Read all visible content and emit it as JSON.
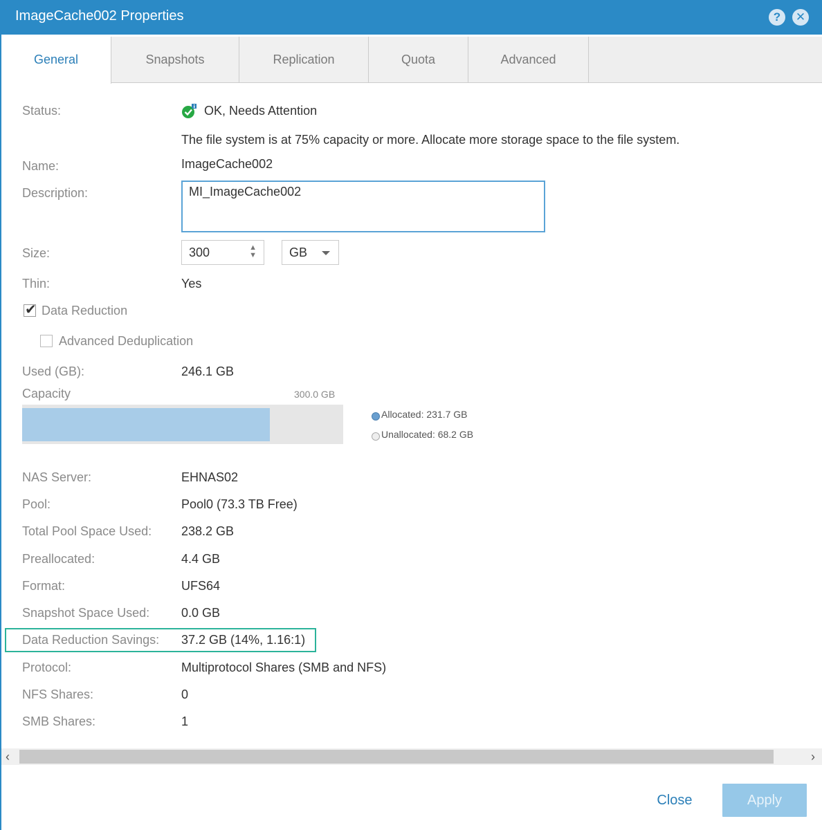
{
  "window": {
    "title": "ImageCache002 Properties",
    "help_icon": "question-circle-icon",
    "close_icon": "close-circle-icon",
    "accent": "#2b8ac6"
  },
  "tabs": [
    {
      "label": "General",
      "active": true
    },
    {
      "label": "Snapshots",
      "active": false
    },
    {
      "label": "Replication",
      "active": false
    },
    {
      "label": "Quota",
      "active": false
    },
    {
      "label": "Advanced",
      "active": false
    }
  ],
  "general": {
    "status_label": "Status:",
    "status_value": "OK, Needs Attention",
    "status_icon": "check-circle-info-icon",
    "status_message": "The file system is at 75% capacity or more. Allocate more storage space to the file system.",
    "name_label": "Name:",
    "name_value": "ImageCache002",
    "description_label": "Description:",
    "description_value": "MI_ImageCache002",
    "size_label": "Size:",
    "size_value": "300",
    "size_unit": "GB",
    "thin_label": "Thin:",
    "thin_value": "Yes",
    "data_reduction_label": "Data Reduction",
    "data_reduction_checked": true,
    "advanced_dedup_label": "Advanced Deduplication",
    "advanced_dedup_checked": false,
    "used_label": "Used (GB):",
    "used_value": "246.1 GB"
  },
  "capacity": {
    "label": "Capacity",
    "total_label": "300.0 GB",
    "allocated_label": "Allocated: 231.7 GB",
    "unallocated_label": "Unallocated: 68.2 GB",
    "allocated_fraction": 0.772,
    "allocated_color": "#a8cce8",
    "unallocated_color": "#e6e6e6"
  },
  "details": [
    {
      "label": "NAS Server:",
      "value": "EHNAS02"
    },
    {
      "label": "Pool:",
      "value": "Pool0 (73.3 TB Free)"
    },
    {
      "label": "Total Pool Space Used:",
      "value": "238.2 GB"
    },
    {
      "label": "Preallocated:",
      "value": "4.4 GB"
    },
    {
      "label": "Format:",
      "value": "UFS64"
    },
    {
      "label": "Snapshot Space Used:",
      "value": "0.0 GB"
    },
    {
      "label": "Data Reduction Savings:",
      "value": "37.2 GB (14%, 1.16:1)"
    },
    {
      "label": "Protocol:",
      "value": "Multiprotocol Shares (SMB and NFS)"
    },
    {
      "label": "NFS Shares:",
      "value": "0"
    },
    {
      "label": "SMB Shares:",
      "value": "1"
    }
  ],
  "footer": {
    "close_label": "Close",
    "apply_label": "Apply"
  }
}
